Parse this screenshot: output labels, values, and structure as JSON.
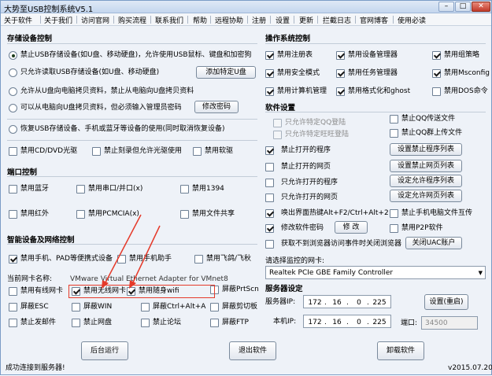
{
  "window": {
    "title": "大势至USB控制系统V5.1",
    "min_label": "–",
    "max_label": "□",
    "close_label": "✕"
  },
  "menu": [
    "关于软件",
    "关于我们",
    "访问官网",
    "购买流程",
    "联系我们",
    "帮助",
    "远程协助",
    "注册",
    "设置",
    "更新",
    "拦截日志",
    "官网博客",
    "使用必读"
  ],
  "storage": {
    "title": "存储设备控制",
    "opt1": "禁止USB存储设备(如U盘、移动硬盘)，允许使用USB鼠标、键盘和加密狗",
    "opt2": "只允许读取USB存储设备(如U盘、移动硬盘)",
    "opt2_button": "添加特定U盘",
    "opt3": "允许从U盘向电脑拷贝资料，禁止从电脑向U盘拷贝资料",
    "opt4": "可以从电脑向U盘拷贝资料，但必须输入管理员密码",
    "opt4_button": "修改密码",
    "opt5": "恢复USB存储设备、手机或蓝牙等设备的使用(同时取消恢复设备)",
    "cd": "禁用CD/DVD光驱",
    "burn": "禁止刻录但允许光驱使用",
    "floppy": "禁用软驱"
  },
  "ports": {
    "title": "端口控制",
    "bluetooth": "禁用蓝牙",
    "serial": "禁用串口/并口(x)",
    "p1394": "禁用1394",
    "infrared": "禁用红外",
    "pcmcia": "禁用PCMCIA(x)",
    "fileshare": "禁用文件共享"
  },
  "smart": {
    "title": "智能设备及网络控制",
    "phone": "禁用手机、PAD等便携式设备",
    "assistant": "禁用手机助手",
    "flight": "禁用飞鸽/飞秋",
    "nic_label": "当前网卡名称:",
    "nic_value": "VMware Virtual Ethernet Adapter for VMnet8",
    "wired": "禁用有线网卡",
    "wireless": "禁用无线网卡",
    "wifi": "禁用随身wifi",
    "prtscn": "屏蔽PrtScn",
    "esc": "屏蔽ESC",
    "win": "屏蔽WIN",
    "ctrlalt": "屏蔽Ctrl+Alt+A",
    "clipboard": "屏蔽剪切板",
    "mail": "禁止发邮件",
    "netdisk": "禁止网盘",
    "forum": "禁止论坛",
    "ftp": "屏蔽FTP"
  },
  "os": {
    "title": "操作系统控制",
    "registry": "禁用注册表",
    "devmgr": "禁用设备管理器",
    "gpedit": "禁用组策略",
    "safemode": "禁用安全模式",
    "taskmgr": "禁用任务管理器",
    "msconfig": "禁用Msconfig",
    "compmgmt": "禁用计算机管理",
    "format": "禁用格式化和ghost",
    "dos": "禁用DOS命令"
  },
  "software": {
    "title": "软件设置",
    "qq_only": "只允许特定QQ登陆",
    "qq_file": "禁止QQ传送文件",
    "ww_only": "只允许特定旺旺登陆",
    "qq_group": "禁止QQ群上传文件",
    "block_prog": "禁止打开的程序",
    "block_prog_btn": "设置禁止程序列表",
    "block_web": "禁止打开的网页",
    "block_web_btn": "设置禁止网页列表",
    "allow_prog": "只允许打开的程序",
    "allow_prog_btn": "设定允许程序列表",
    "allow_web": "只允许打开的网页",
    "allow_web_btn": "设定允许网页列表",
    "hotkey": "唤出界面热键Alt+F2/Ctrl+Alt+2",
    "phone_transfer": "禁止手机电脑文件互传",
    "pwd": "修改软件密码",
    "pwd_btn": "修 改",
    "p2p": "禁用P2P软件",
    "proxy": "获取不到浏览器访问事件时关闭浏览器",
    "uac_btn": "关闭UAC账户"
  },
  "nic": {
    "label": "请选择监控的网卡:",
    "value": "Realtek PCIe GBE Family Controller",
    "arrow": "▼"
  },
  "server": {
    "title": "服务器设定",
    "ip_label": "服务器IP:",
    "ip": [
      "172",
      "16",
      "0",
      "225"
    ],
    "local_label": "本机IP:",
    "local_ip": [
      "172",
      "16",
      "0",
      "225"
    ],
    "reset_btn": "设置(重启)",
    "port_label": "端口:",
    "port": "34500",
    "dot": "."
  },
  "actions": {
    "run_bg": "后台运行",
    "exit": "退出软件",
    "uninstall": "卸载软件"
  },
  "status": {
    "message": "成功连接到服务器!",
    "version": "v2015.07.20"
  },
  "colors": {
    "annotation": "#e53a2a",
    "window_border": "#7a9cc6"
  }
}
